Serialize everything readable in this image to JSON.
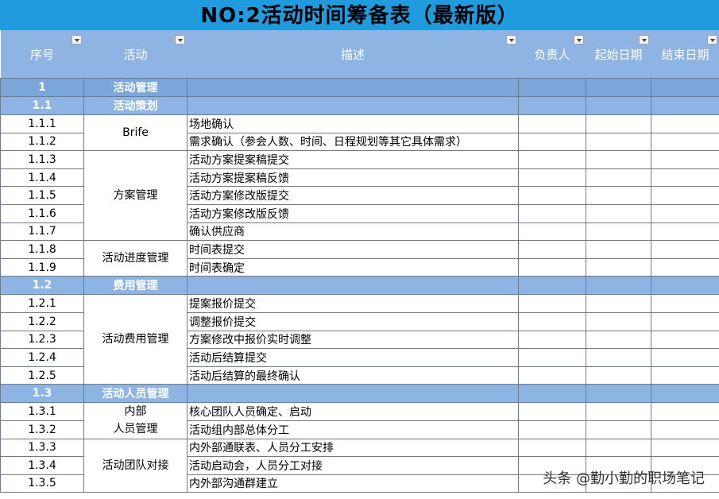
{
  "title": "NO:2活动时间筹备表（最新版）",
  "headers": {
    "seq": "序号",
    "activity": "活动",
    "desc": "描述",
    "owner": "负责人",
    "start": "起始日期",
    "end": "结束日期"
  },
  "sections": [
    {
      "no": "1",
      "name": "活动管理"
    },
    {
      "no": "1.1",
      "name": "活动策划"
    },
    {
      "no": "1.2",
      "name": "费用管理"
    },
    {
      "no": "1.3",
      "name": "活动人员管理"
    }
  ],
  "groups": {
    "brife": "Brife",
    "plan_mgmt": "方案管理",
    "progress_mgmt": "活动进度管理",
    "cost_mgmt": "活动费用管理",
    "internal_a": "内部",
    "internal_b": "人员管理",
    "team_dock": "活动团队对接"
  },
  "rows": [
    {
      "no": "1.1.1",
      "desc": "场地确认"
    },
    {
      "no": "1.1.2",
      "desc": "需求确认（参会人数、时间、日程规划等其它具体需求）"
    },
    {
      "no": "1.1.3",
      "desc": "活动方案提案稿提交"
    },
    {
      "no": "1.1.4",
      "desc": "活动方案提案稿反馈"
    },
    {
      "no": "1.1.5",
      "desc": "活动方案修改版提交"
    },
    {
      "no": "1.1.6",
      "desc": "活动方案修改版反馈"
    },
    {
      "no": "1.1.7",
      "desc": "确认供应商"
    },
    {
      "no": "1.1.8",
      "desc": "时间表提交"
    },
    {
      "no": "1.1.9",
      "desc": "时间表确定"
    },
    {
      "no": "1.2.1",
      "desc": "提案报价提交"
    },
    {
      "no": "1.2.2",
      "desc": "调整报价提交"
    },
    {
      "no": "1.2.3",
      "desc": "方案修改中报价实时调整"
    },
    {
      "no": "1.2.4",
      "desc": "活动后结算提交"
    },
    {
      "no": "1.2.5",
      "desc": "活动后结算的最终确认"
    },
    {
      "no": "1.3.1",
      "desc": "核心团队人员确定、启动"
    },
    {
      "no": "1.3.2",
      "desc": "活动组内部总体分工"
    },
    {
      "no": "1.3.3",
      "desc": "内外部通联表、人员分工安排"
    },
    {
      "no": "1.3.4",
      "desc": "活动启动会，人员分工对接"
    },
    {
      "no": "1.3.5",
      "desc": "内外部沟通群建立"
    }
  ],
  "watermark": "头条 @勤小勤的职场笔记"
}
